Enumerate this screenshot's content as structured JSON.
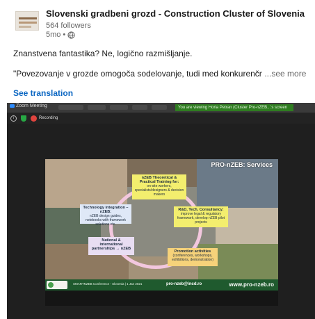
{
  "post": {
    "org_name": "Slovenski gradbeni grozd - Construction Cluster of Slovenia",
    "followers": "564 followers",
    "age": "5mo",
    "separator": "•",
    "line1": "Znanstvena fantastika? Ne, logično razmišljanje.",
    "line2": "\"Povezovanje v grozde omogoča sodelovanje, tudi med konkurenčnim",
    "see_more": "...see more",
    "see_translation": "See translation"
  },
  "zoom": {
    "window_title": "Zoom Meeting",
    "viewing_banner": "You are viewing Horia Petran (Cluster Pro-nZEB...'s screen",
    "recording_label": "Recording",
    "info_glyph": "i"
  },
  "slide": {
    "title": "PRO-nZEB: Services",
    "boxes": {
      "training_title": "nZEB Theoretical & Practical Training for:",
      "training_body": "on-site workers, specialists/designers & decision makers",
      "tech_title": "Technology integration – nZEB:",
      "tech_body": "nZEB design guides, notebooks with framework solutions etc.",
      "rd_title": "R&D, Tech. Consultancy:",
      "rd_body": "improve legal & regulatory framework, develop nZEB pilot projects",
      "partner_title": "National & international partnerships → nZEB",
      "promo_title": "Promotion activities",
      "promo_body": "(conferences, workshops, exhibitions, demonstration)"
    },
    "footer_conf": "SMARTNZEB Conference - Slovenia | 1 Jan 2021",
    "footer_mail": "pro-nzeb@incd.ro",
    "footer_url": "www.pro-nzeb.ro"
  },
  "icons": {
    "globe": "globe-icon",
    "info": "info-icon",
    "shield": "shield-icon",
    "record": "record-icon"
  },
  "colors": {
    "link_blue": "#0a66c2",
    "zoom_banner_green": "#2f7d21",
    "slide_footer_green": "#1f5a2e",
    "ring_pink": "#f2c7de"
  }
}
